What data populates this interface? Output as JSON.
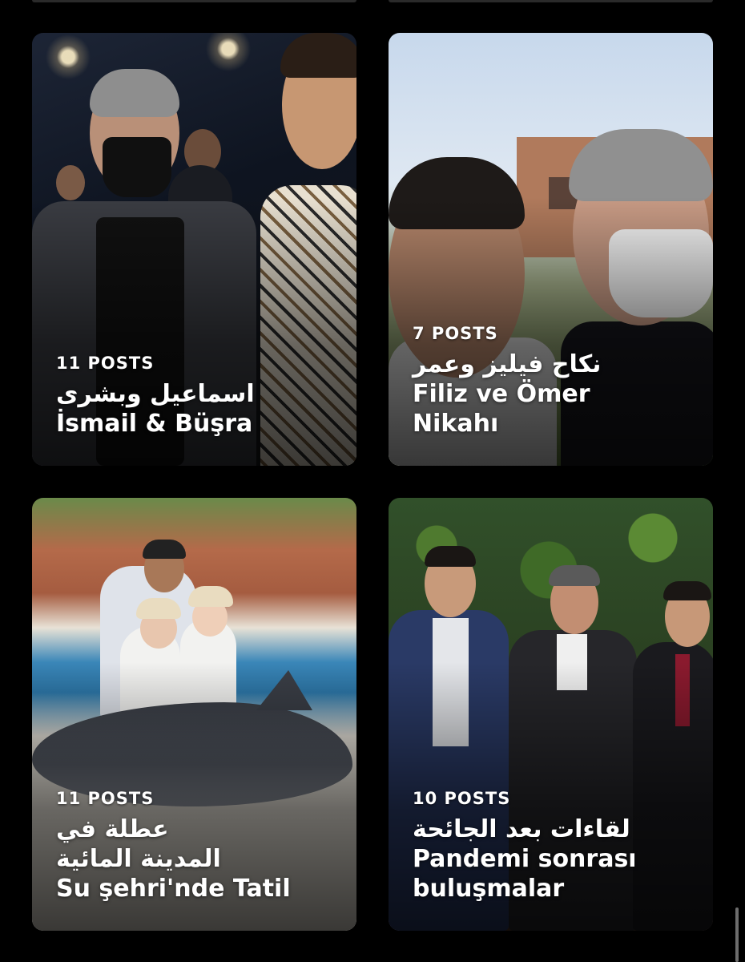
{
  "collections": [
    {
      "count": "11 POSTS",
      "title_lines": [
        "اسماعيل وبشرى",
        "İsmail & Büşra"
      ]
    },
    {
      "count": "7 POSTS",
      "title_lines": [
        "نكاح فيليز وعمر",
        "Filiz ve Ömer",
        "Nikahı"
      ]
    },
    {
      "count": "11 POSTS",
      "title_lines": [
        "عطلة في",
        "المدينة المائية",
        "Su şehri'nde Tatil"
      ]
    },
    {
      "count": "10 POSTS",
      "title_lines": [
        "لقاءات بعد الجائحة",
        "Pandemi sonrası",
        "buluşmalar"
      ]
    }
  ]
}
